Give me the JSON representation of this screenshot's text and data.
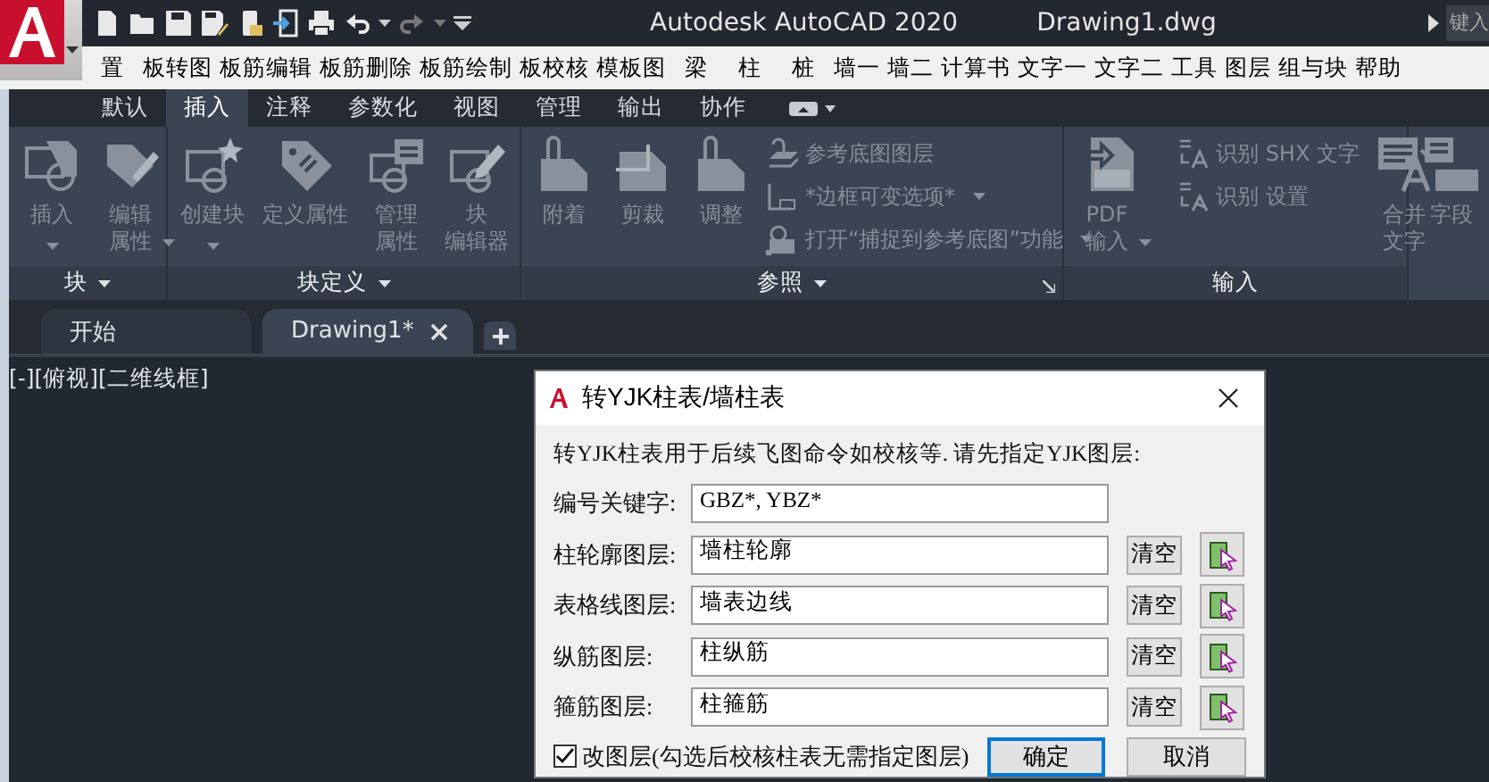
{
  "title_bar": {
    "title": "Autodesk AutoCAD 2020",
    "file": "Drawing1.dwg",
    "search": {
      "placeholder": "键入"
    }
  },
  "menu_bar": [
    "置",
    "板转图",
    "板筋编辑",
    "板筋删除",
    "板筋绘制",
    "板校核",
    "模板图",
    "梁",
    "柱",
    "桩",
    "墙一",
    "墙二",
    "计算书",
    "文字一",
    "文字二",
    "工具",
    "图层",
    "组与块",
    "帮助"
  ],
  "ribbon_tabs": [
    {
      "label": "默认",
      "selected": false
    },
    {
      "label": "插入",
      "selected": true
    },
    {
      "label": "注释",
      "selected": false
    },
    {
      "label": "参数化",
      "selected": false
    },
    {
      "label": "视图",
      "selected": false
    },
    {
      "label": "管理",
      "selected": false
    },
    {
      "label": "输出",
      "selected": false
    },
    {
      "label": "协作",
      "selected": false
    }
  ],
  "ribbon_panels": [
    {
      "title": "块",
      "menu": true,
      "launcher": false,
      "items": [
        {
          "kind": "large",
          "lines": [
            "插入"
          ],
          "dropdown": true,
          "disabled": true
        },
        {
          "kind": "large",
          "lines": [
            "编辑",
            "属性"
          ],
          "dropdown": true,
          "disabled": true
        }
      ]
    },
    {
      "title": "块定义",
      "menu": true,
      "launcher": false,
      "items": [
        {
          "kind": "large",
          "lines": [
            "创建块"
          ],
          "dropdown": true,
          "disabled": true
        },
        {
          "kind": "large",
          "lines": [
            "定义属性"
          ],
          "dropdown": false,
          "disabled": true
        },
        {
          "kind": "large",
          "lines": [
            "管理",
            "属性"
          ],
          "dropdown": false,
          "disabled": true
        },
        {
          "kind": "large",
          "lines": [
            "块",
            "编辑器"
          ],
          "dropdown": false,
          "disabled": true
        }
      ]
    },
    {
      "title": "参照",
      "menu": true,
      "launcher": true,
      "items": [
        {
          "kind": "large",
          "lines": [
            "附着"
          ],
          "dropdown": false,
          "disabled": true
        },
        {
          "kind": "large",
          "lines": [
            "剪裁"
          ],
          "dropdown": false,
          "disabled": true
        },
        {
          "kind": "large",
          "lines": [
            "调整"
          ],
          "dropdown": false,
          "disabled": true
        },
        {
          "kind": "small_stack",
          "rows": [
            {
              "label": "参考底图图层",
              "dropdown": false,
              "disabled": true
            },
            {
              "label": "*边框可变选项*",
              "dropdown": true,
              "disabled": true
            },
            {
              "label": "打开“捕捉到参考底图”功能",
              "dropdown": true,
              "disabled": true
            }
          ]
        }
      ]
    },
    {
      "title": "输入",
      "menu": false,
      "launcher": false,
      "items": [
        {
          "kind": "large",
          "lines": [
            "PDF",
            "输入"
          ],
          "dropdown": true,
          "disabled": true
        },
        {
          "kind": "separator"
        },
        {
          "kind": "small_stack",
          "rows": [
            {
              "label": "识别 SHX 文字",
              "dropdown": false,
              "disabled": true
            },
            {
              "label": "识别 设置",
              "dropdown": false,
              "disabled": true
            }
          ]
        },
        {
          "kind": "large",
          "lines": [
            "合并",
            "文字"
          ],
          "dropdown": false,
          "disabled": true
        }
      ]
    },
    {
      "items": [
        {
          "kind": "large",
          "lines": [
            "字段"
          ],
          "dropdown": false,
          "disabled": true
        }
      ]
    }
  ],
  "doc_tabs": [
    {
      "label": "开始",
      "selected": false,
      "closable": false
    },
    {
      "label": "Drawing1*",
      "selected": true,
      "closable": true
    }
  ],
  "viewport_label": "[-][俯视][二维线框]",
  "dialog": {
    "title": "转YJK柱表/墙柱表",
    "intro": "转YJK柱表用于后续飞图命令如校核等. 请先指定YJK图层:",
    "fields": [
      {
        "kind": "text",
        "label": "编号关键字:",
        "value": "GBZ*, YBZ*"
      },
      {
        "kind": "layer",
        "label": "柱轮廓图层:",
        "value": "墙柱轮廓",
        "clear": "清空"
      },
      {
        "kind": "layer",
        "label": "表格线图层:",
        "value": "墙表边线",
        "clear": "清空"
      },
      {
        "kind": "layer",
        "label": "纵筋图层:",
        "value": "柱纵筋",
        "clear": "清空"
      },
      {
        "kind": "layer",
        "label": "箍筋图层:",
        "value": "柱箍筋",
        "clear": "清空"
      }
    ],
    "checkbox": {
      "label": "改图层(勾选后校核柱表无需指定图层)",
      "checked": true
    },
    "buttons": [
      {
        "label": "确定",
        "focused": true
      },
      {
        "label": "取消",
        "focused": false
      }
    ]
  }
}
